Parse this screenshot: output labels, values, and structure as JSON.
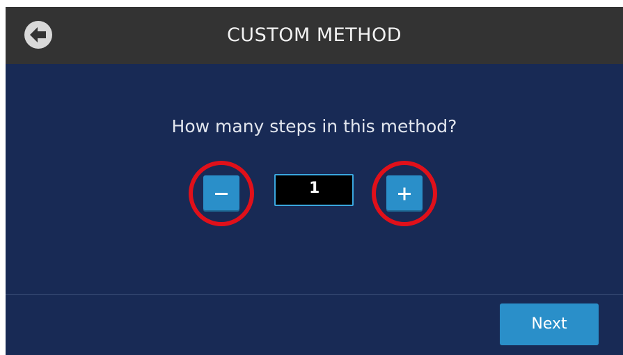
{
  "header": {
    "title": "CUSTOM METHOD",
    "back_icon": "back-arrow-circle-icon"
  },
  "main": {
    "question": "How many steps in this method?",
    "steps_value": "1",
    "decrement_icon": "minus-icon",
    "increment_icon": "plus-icon"
  },
  "footer": {
    "next_label": "Next"
  },
  "colors": {
    "background": "#182a55",
    "header": "#333333",
    "button": "#2a8fc9",
    "highlight": "#e0101a",
    "value_border": "#3aa7df"
  }
}
